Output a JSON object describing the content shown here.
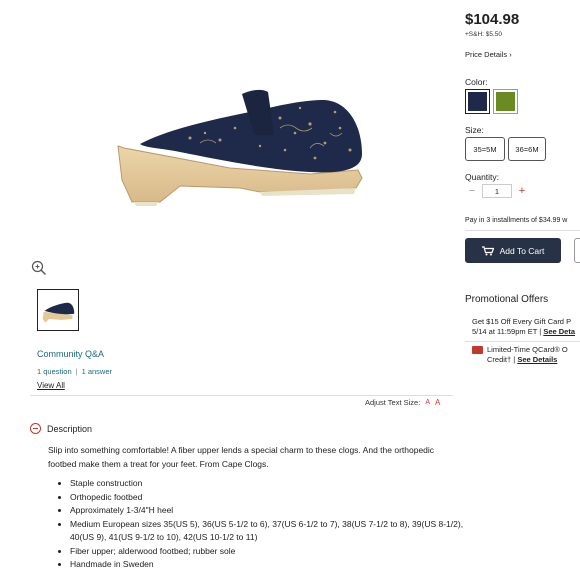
{
  "product": {
    "image_alt": "Navy embroidered clog with wooden sole"
  },
  "community": {
    "title": "Community Q&A",
    "questions": "1 question",
    "answers": "1 answer",
    "view_all": "View All"
  },
  "adjust_text": {
    "label": "Adjust Text Size:",
    "small": "A",
    "large": "A"
  },
  "description": {
    "heading": "Description",
    "text": "Slip into something comfortable! A fiber upper lends a special charm to these clogs. And the orthopedic footbed make them a treat for your feet. From Cape Clogs.",
    "bullets": [
      "Staple construction",
      "Orthopedic footbed",
      "Approximately 1-3/4\"H heel",
      "Medium European sizes 35(US 5), 36(US 5-1/2 to 6), 37(US 6-1/2 to 7), 38(US 7-1/2 to 8), 39(US 8-1/2), 40(US 9), 41(US 9-1/2 to 10), 42(US 10-1/2 to 11)",
      "Fiber upper; alderwood footbed; rubber sole",
      "Handmade in Sweden"
    ]
  },
  "purchase": {
    "price": "$104.98",
    "shipping": "+S&H: $5.50",
    "price_details": "Price Details",
    "color_label": "Color:",
    "colors": [
      "#1f2a4a",
      "#6a8a22"
    ],
    "size_label": "Size:",
    "sizes": [
      "35=5M",
      "36=6M"
    ],
    "quantity_label": "Quantity:",
    "quantity": "1",
    "installments": "Pay in 3 installments of $34.99 w",
    "add_to_cart": "Add To Cart"
  },
  "promotions": {
    "title": "Promotional Offers",
    "offer1_line1": "Get $15 Off Every Gift Card P",
    "offer1_line2": "5/14 at 11:59pm ET |",
    "offer1_link": "See Deta",
    "offer2_line1": "Limited-Time QCard® O",
    "offer2_line2": "Credit† |",
    "offer2_link": "See Details"
  }
}
